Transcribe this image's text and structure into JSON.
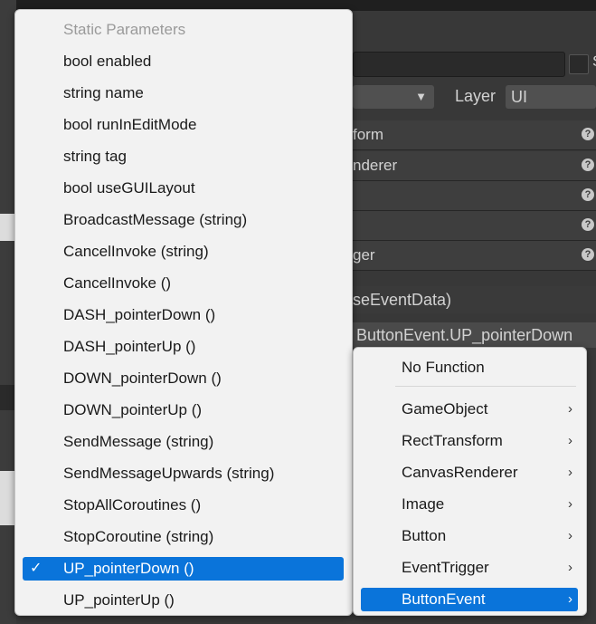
{
  "inspector": {
    "layer_label": "Layer",
    "layer_value": "UI",
    "name_suffix": "S",
    "rows": [
      "form",
      "nderer",
      "",
      "",
      "ger"
    ],
    "event_signature": "seEventData)",
    "selected_function": "ButtonEvent.UP_pointerDown",
    "help_glyph": "?"
  },
  "menu": {
    "header": "Static Parameters",
    "items": [
      "bool enabled",
      "string name",
      "bool runInEditMode",
      "string tag",
      "bool useGUILayout",
      "BroadcastMessage (string)",
      "CancelInvoke (string)",
      "CancelInvoke ()",
      "DASH_pointerDown ()",
      "DASH_pointerUp ()",
      "DOWN_pointerDown ()",
      "DOWN_pointerUp ()",
      "SendMessage (string)",
      "SendMessageUpwards (string)",
      "StopAllCoroutines ()",
      "StopCoroutine (string)",
      "UP_pointerDown ()",
      "UP_pointerUp ()"
    ],
    "checked_item": "UP_pointerDown ()",
    "check_glyph": "✓"
  },
  "submenu": {
    "no_function": "No Function",
    "items": [
      "GameObject",
      "RectTransform",
      "CanvasRenderer",
      "Image",
      "Button",
      "EventTrigger",
      "ButtonEvent"
    ],
    "highlighted_item": "ButtonEvent",
    "chevron_glyph": "›"
  },
  "colors": {
    "highlight": "#0a74da",
    "menu_bg": "#f2f2f2",
    "editor_bg": "#383838"
  }
}
